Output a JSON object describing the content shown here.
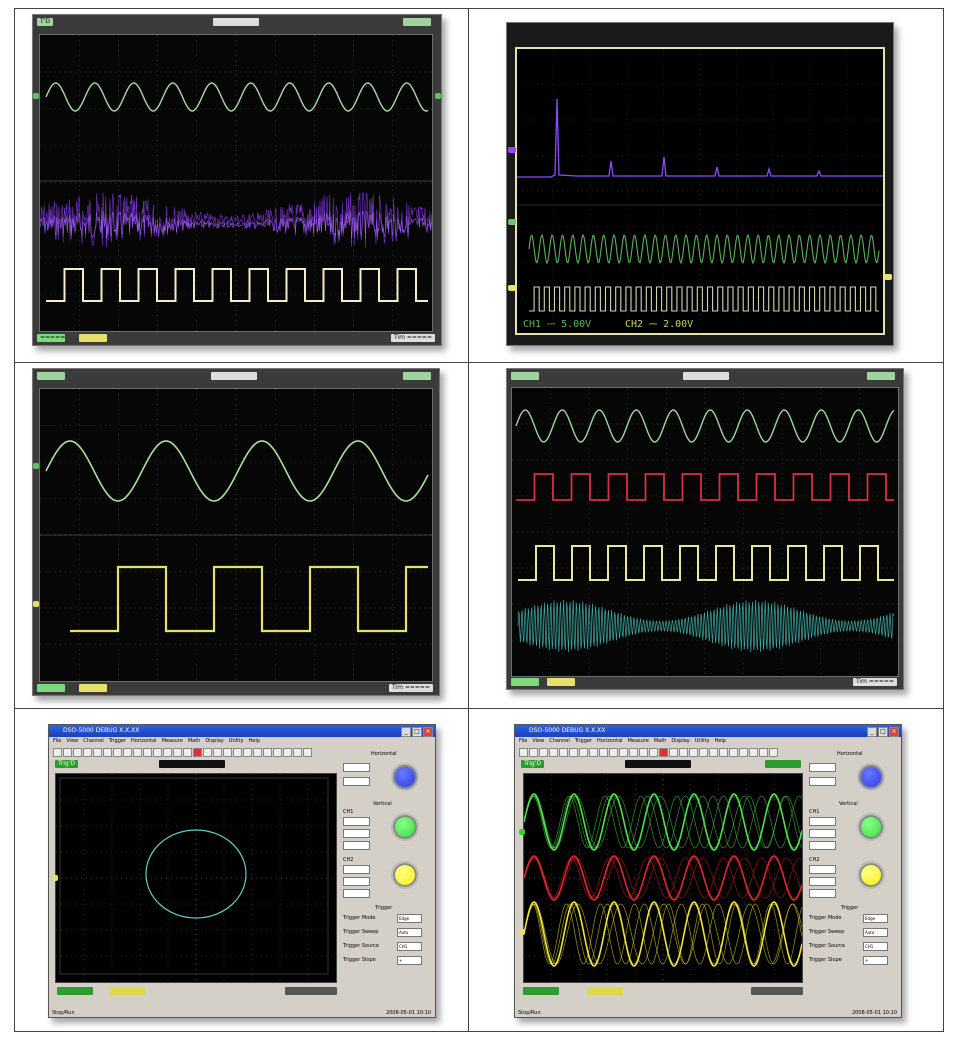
{
  "panel1": {
    "trig_label": "T'D",
    "ch1": "CH1",
    "ch2": "CH2",
    "footer_left": "=====",
    "footer_right": "Tim  ====="
  },
  "panel2": {
    "ch1_readout": "CH1 ⎓ 5.00V",
    "ch2_readout": "CH2 ⎓ 2.00V"
  },
  "panel3": {
    "footer_right": "Tim ====="
  },
  "panel4": {
    "footer_right": "Tim ====="
  },
  "panel5": {
    "title": "DSO-5000 DEBUG X.X.XX",
    "menu": [
      "File",
      "View",
      "Channel",
      "Trigger",
      "Horizontal",
      "Measure",
      "Math",
      "Display",
      "Utility",
      "Help"
    ],
    "trig_status": "Trig'D",
    "horizontal_label": "Horizontal",
    "vertical_label": "Vertical",
    "ch1_check": "CH1",
    "ch2_check": "CH2",
    "trigger_label": "Trigger",
    "trigger_rows": [
      "Trigger Mode",
      "Trigger Sweep",
      "Trigger Source",
      "Trigger Slope"
    ],
    "trigger_values": [
      "Edge",
      "Auto",
      "CH1",
      "+"
    ],
    "status_left": "Stop/Run",
    "status_right": "2008-05-01  10:10",
    "knob_colors": [
      "#1f33e6",
      "#2cd62c",
      "#f4ee00"
    ]
  },
  "panel6": {
    "title": "DSO-5000 DEBUG X.X.XX",
    "menu": [
      "File",
      "View",
      "Channel",
      "Trigger",
      "Horizontal",
      "Measure",
      "Math",
      "Display",
      "Utility",
      "Help"
    ],
    "trig_status": "Trig'D",
    "horizontal_label": "Horizontal",
    "vertical_label": "Vertical",
    "ch1_check": "CH1",
    "ch2_check": "CH2",
    "trigger_label": "Trigger",
    "trigger_rows": [
      "Trigger Mode",
      "Trigger Sweep",
      "Trigger Source",
      "Trigger Slope"
    ],
    "trigger_values": [
      "Edge",
      "Auto",
      "CH1",
      "+"
    ],
    "status_left": "Stop/Run",
    "status_right": "2008-05-01  10:10",
    "knob_colors": [
      "#1f33e6",
      "#2cd62c",
      "#f4ee00"
    ]
  }
}
